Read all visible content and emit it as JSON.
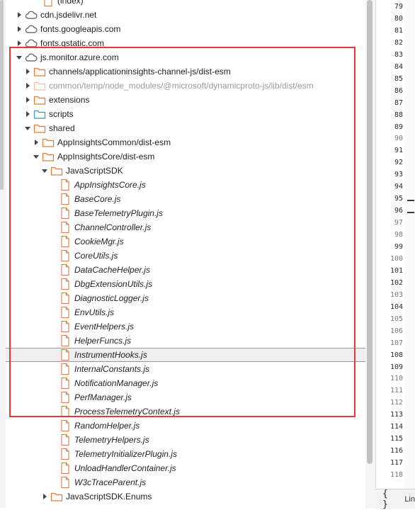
{
  "tree": {
    "items": [
      {
        "label": "(index)",
        "icon": "file-icon",
        "indent": 3,
        "chevron": "none",
        "dim": false
      },
      {
        "label": "cdn.jsdelivr.net",
        "icon": "cloud-icon",
        "indent": 1,
        "chevron": "right",
        "dim": false
      },
      {
        "label": "fonts.googleapis.com",
        "icon": "cloud-icon",
        "indent": 1,
        "chevron": "right",
        "dim": false
      },
      {
        "label": "fonts.gstatic.com",
        "icon": "cloud-icon",
        "indent": 1,
        "chevron": "right",
        "dim": false
      },
      {
        "label": "js.monitor.azure.com",
        "icon": "cloud-icon",
        "indent": 1,
        "chevron": "down",
        "dim": false
      },
      {
        "label": "channels/applicationinsights-channel-js/dist-esm",
        "icon": "folder-icon",
        "indent": 2,
        "chevron": "right",
        "dim": false
      },
      {
        "label": "common/temp/node_modules/@microsoft/dynamicproto-js/lib/dist/esm",
        "icon": "folder-icon",
        "indent": 2,
        "chevron": "right",
        "dim": true
      },
      {
        "label": "extensions",
        "icon": "folder-icon",
        "indent": 2,
        "chevron": "right",
        "dim": false
      },
      {
        "label": "scripts",
        "icon": "folder-teal-icon",
        "indent": 2,
        "chevron": "right",
        "dim": false
      },
      {
        "label": "shared",
        "icon": "folder-icon",
        "indent": 2,
        "chevron": "down",
        "dim": false
      },
      {
        "label": "AppInsightsCommon/dist-esm",
        "icon": "folder-icon",
        "indent": 3,
        "chevron": "right",
        "dim": false
      },
      {
        "label": "AppInsightsCore/dist-esm",
        "icon": "folder-icon",
        "indent": 3,
        "chevron": "down",
        "dim": false
      },
      {
        "label": "JavaScriptSDK",
        "icon": "folder-icon",
        "indent": 4,
        "chevron": "down",
        "dim": false
      },
      {
        "label": "AppInsightsCore.js",
        "icon": "file-icon",
        "indent": 5,
        "chevron": "none",
        "dim": false
      },
      {
        "label": "BaseCore.js",
        "icon": "file-icon",
        "indent": 5,
        "chevron": "none",
        "dim": false
      },
      {
        "label": "BaseTelemetryPlugin.js",
        "icon": "file-icon",
        "indent": 5,
        "chevron": "none",
        "dim": false
      },
      {
        "label": "ChannelController.js",
        "icon": "file-icon",
        "indent": 5,
        "chevron": "none",
        "dim": false
      },
      {
        "label": "CookieMgr.js",
        "icon": "file-icon",
        "indent": 5,
        "chevron": "none",
        "dim": false
      },
      {
        "label": "CoreUtils.js",
        "icon": "file-icon",
        "indent": 5,
        "chevron": "none",
        "dim": false
      },
      {
        "label": "DataCacheHelper.js",
        "icon": "file-icon",
        "indent": 5,
        "chevron": "none",
        "dim": false
      },
      {
        "label": "DbgExtensionUtils.js",
        "icon": "file-icon",
        "indent": 5,
        "chevron": "none",
        "dim": false
      },
      {
        "label": "DiagnosticLogger.js",
        "icon": "file-icon",
        "indent": 5,
        "chevron": "none",
        "dim": false
      },
      {
        "label": "EnvUtils.js",
        "icon": "file-icon",
        "indent": 5,
        "chevron": "none",
        "dim": false
      },
      {
        "label": "EventHelpers.js",
        "icon": "file-icon",
        "indent": 5,
        "chevron": "none",
        "dim": false
      },
      {
        "label": "HelperFuncs.js",
        "icon": "file-icon",
        "indent": 5,
        "chevron": "none",
        "dim": false
      },
      {
        "label": "InstrumentHooks.js",
        "icon": "file-icon",
        "indent": 5,
        "chevron": "none",
        "dim": false,
        "selected": true
      },
      {
        "label": "InternalConstants.js",
        "icon": "file-icon",
        "indent": 5,
        "chevron": "none",
        "dim": false
      },
      {
        "label": "NotificationManager.js",
        "icon": "file-icon",
        "indent": 5,
        "chevron": "none",
        "dim": false
      },
      {
        "label": "PerfManager.js",
        "icon": "file-icon",
        "indent": 5,
        "chevron": "none",
        "dim": false
      },
      {
        "label": "ProcessTelemetryContext.js",
        "icon": "file-icon",
        "indent": 5,
        "chevron": "none",
        "dim": false
      },
      {
        "label": "RandomHelper.js",
        "icon": "file-icon",
        "indent": 5,
        "chevron": "none",
        "dim": false
      },
      {
        "label": "TelemetryHelpers.js",
        "icon": "file-icon",
        "indent": 5,
        "chevron": "none",
        "dim": false
      },
      {
        "label": "TelemetryInitializerPlugin.js",
        "icon": "file-icon",
        "indent": 5,
        "chevron": "none",
        "dim": false
      },
      {
        "label": "UnloadHandlerContainer.js",
        "icon": "file-icon",
        "indent": 5,
        "chevron": "none",
        "dim": false
      },
      {
        "label": "W3cTraceParent.js",
        "icon": "file-icon",
        "indent": 5,
        "chevron": "none",
        "dim": false
      },
      {
        "label": "JavaScriptSDK.Enums",
        "icon": "folder-icon",
        "indent": 4,
        "chevron": "right",
        "dim": false
      }
    ]
  },
  "gutter": {
    "lines": [
      {
        "n": "79",
        "dim": false
      },
      {
        "n": "80",
        "dim": false
      },
      {
        "n": "81",
        "dim": false
      },
      {
        "n": "82",
        "dim": false
      },
      {
        "n": "83",
        "dim": false
      },
      {
        "n": "84",
        "dim": false
      },
      {
        "n": "85",
        "dim": false
      },
      {
        "n": "86",
        "dim": false
      },
      {
        "n": "87",
        "dim": false
      },
      {
        "n": "88",
        "dim": false
      },
      {
        "n": "89",
        "dim": false
      },
      {
        "n": "90",
        "dim": true
      },
      {
        "n": "91",
        "dim": false
      },
      {
        "n": "92",
        "dim": false
      },
      {
        "n": "93",
        "dim": false
      },
      {
        "n": "94",
        "dim": false
      },
      {
        "n": "95",
        "dim": false
      },
      {
        "n": "96",
        "dim": false
      },
      {
        "n": "97",
        "dim": true
      },
      {
        "n": "98",
        "dim": true
      },
      {
        "n": "99",
        "dim": false
      },
      {
        "n": "100",
        "dim": true
      },
      {
        "n": "101",
        "dim": false
      },
      {
        "n": "102",
        "dim": false
      },
      {
        "n": "103",
        "dim": true
      },
      {
        "n": "104",
        "dim": false
      },
      {
        "n": "105",
        "dim": true
      },
      {
        "n": "106",
        "dim": true
      },
      {
        "n": "107",
        "dim": true
      },
      {
        "n": "108",
        "dim": false
      },
      {
        "n": "109",
        "dim": false
      },
      {
        "n": "110",
        "dim": true
      },
      {
        "n": "111",
        "dim": true
      },
      {
        "n": "112",
        "dim": true
      },
      {
        "n": "113",
        "dim": false
      },
      {
        "n": "114",
        "dim": false
      },
      {
        "n": "115",
        "dim": false
      },
      {
        "n": "116",
        "dim": false
      },
      {
        "n": "117",
        "dim": false
      },
      {
        "n": "118",
        "dim": true
      }
    ],
    "fold_markers": [
      16,
      17
    ]
  },
  "status": {
    "format_label": "{ }",
    "position_label": "Lin"
  },
  "colors": {
    "folder": "#e07a3a",
    "folder_teal": "#3a9bb0",
    "file": "#e07a3a",
    "highlight_box": "#e53935",
    "selection": "#eeeeee"
  }
}
